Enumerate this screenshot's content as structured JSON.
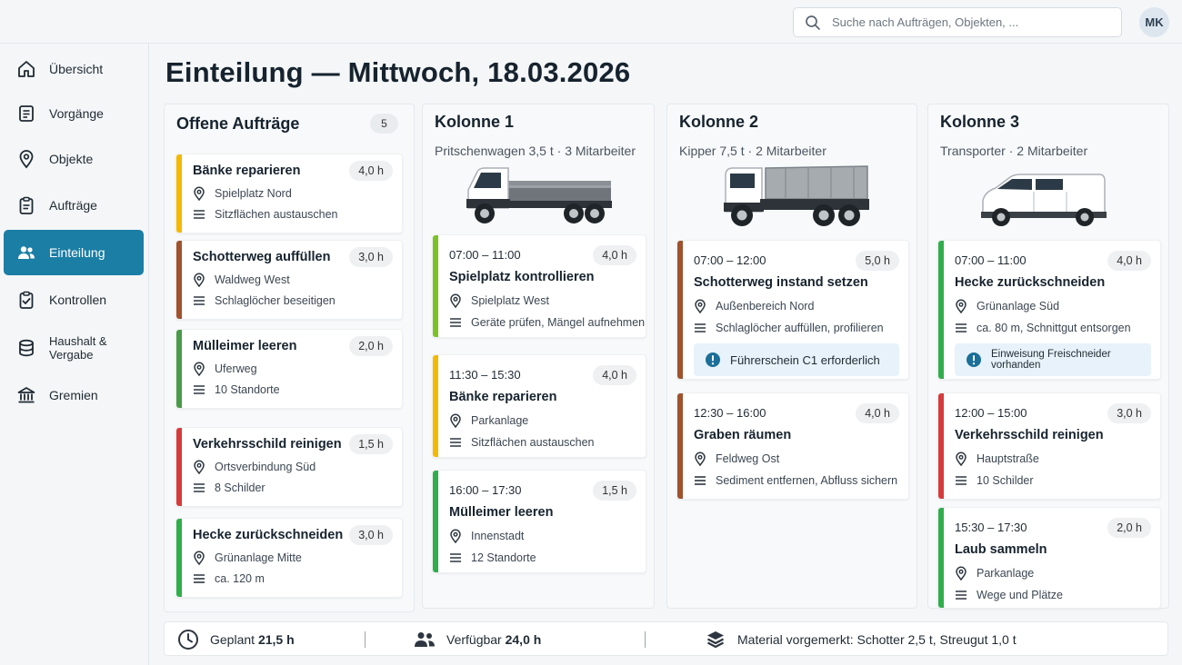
{
  "search": {
    "placeholder": "Suche nach Aufträgen, Objekten, ..."
  },
  "user": {
    "initials": "MK"
  },
  "nav": [
    "Übersicht",
    "Vorgänge",
    "Objekte",
    "Aufträge",
    "Einteilung",
    "Kontrollen",
    "Haushalt & Vergabe",
    "Gremien"
  ],
  "page_title": "Einteilung — Mittwoch, 18.03.2026",
  "open": {
    "title": "Offene Aufträge",
    "count": "5",
    "cards": [
      {
        "title": "Bänke reparieren",
        "hours": "4,0 h",
        "location": "Spielplatz Nord",
        "task": "Sitzflächen austauschen",
        "color": "#f5b800"
      },
      {
        "title": "Schotterweg auffüllen",
        "hours": "3,0 h",
        "location": "Waldweg West",
        "task": "Schlaglöcher beseitigen",
        "color": "#a0522d"
      },
      {
        "title": "Mülleimer leeren",
        "hours": "2,0 h",
        "location": "Uferweg",
        "task": "10 Standorte",
        "color": "#4a9a4a"
      },
      {
        "title": "Verkehrsschild reinigen",
        "hours": "1,5 h",
        "location": "Ortsverbindung Süd",
        "task": "8 Schilder",
        "color": "#d63b3b"
      },
      {
        "title": "Hecke zurückschneiden",
        "hours": "3,0 h",
        "location": "Grünanlage Mitte",
        "task": "ca. 120 m",
        "color": "#2fae4b"
      }
    ]
  },
  "columns": [
    {
      "title": "Kolonne 1",
      "vehicle": "Pritschenwagen 3,5 t",
      "crew": "3 Mitarbeiter",
      "cards": [
        {
          "time": "07:00 – 11:00",
          "hours": "4,0 h",
          "title": "Spielplatz kontrollieren",
          "location": "Spielplatz West",
          "task": "Geräte prüfen, Mängel aufnehmen",
          "color": "#7cc225"
        },
        {
          "time": "11:30 – 15:30",
          "hours": "4,0 h",
          "title": "Bänke reparieren",
          "location": "Parkanlage",
          "task": "Sitzflächen austauschen",
          "color": "#f5b800"
        },
        {
          "time": "16:00 – 17:30",
          "hours": "1,5 h",
          "title": "Mülleimer leeren",
          "location": "Innenstadt",
          "task": "12 Standorte",
          "color": "#2fae4b"
        }
      ]
    },
    {
      "title": "Kolonne 2",
      "vehicle": "Kipper 7,5 t",
      "crew": "2 Mitarbeiter",
      "cards": [
        {
          "time": "07:00 – 12:00",
          "hours": "5,0 h",
          "title": "Schotterweg instand setzen",
          "location": "Außenbereich Nord",
          "task": "Schlaglöcher auffüllen, profilieren",
          "color": "#a0522d",
          "note": "Führerschein C1 erforderlich"
        },
        {
          "time": "12:30 – 16:00",
          "hours": "4,0 h",
          "title": "Graben räumen",
          "location": "Feldweg Ost",
          "task": "Sediment entfernen, Abfluss sichern",
          "color": "#a0522d"
        }
      ]
    },
    {
      "title": "Kolonne 3",
      "vehicle": "Transporter",
      "crew": "2 Mitarbeiter",
      "cards": [
        {
          "time": "07:00 – 11:00",
          "hours": "4,0 h",
          "title": "Hecke zurückschneiden",
          "location": "Grünanlage Süd",
          "task": "ca. 80 m, Schnittgut entsorgen",
          "color": "#2fae4b",
          "note": "Einweisung Freischneider vorhanden"
        },
        {
          "time": "12:00 – 15:00",
          "hours": "3,0 h",
          "title": "Verkehrsschild reinigen",
          "location": "Hauptstraße",
          "task": "10 Schilder",
          "color": "#d63b3b"
        },
        {
          "time": "15:30 – 17:30",
          "hours": "2,0 h",
          "title": "Laub sammeln",
          "location": "Parkanlage",
          "task": "Wege und Plätze",
          "color": "#2fae4b"
        }
      ]
    }
  ],
  "footer": {
    "planned_label": "Geplant",
    "planned_value": "21,5 h",
    "available_label": "Verfügbar",
    "available_value": "24,0 h",
    "material": "Material vorgemerkt: Schotter 2,5 t, Streugut 1,0 t"
  }
}
